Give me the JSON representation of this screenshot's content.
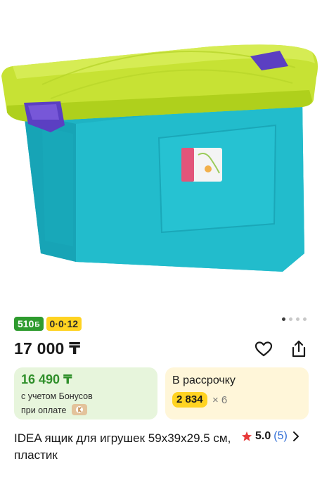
{
  "product": {
    "image_alt": "Пластиковый ящик с крышкой",
    "pager": {
      "count": 4,
      "active_index": 0
    },
    "badges": {
      "bonus": "510",
      "bonus_currency": "Б",
      "installment": "0·0·12"
    },
    "price": "17 000 ₸",
    "actions": {
      "favorite_icon": "heart-icon",
      "share_icon": "share-icon"
    },
    "bonus_card": {
      "price": "16 490 ₸",
      "line1": "с учетом Бонусов",
      "line2": "при оплате",
      "pay_icon": "kaspi-pay-icon"
    },
    "installment_card": {
      "title": "В рассрочку",
      "amount": "2 834",
      "months": "× 6"
    },
    "title": "IDEA ящик для игрушек 59x39x29.5 см, пластик",
    "rating": {
      "value": "5.0",
      "count": "(5)"
    }
  },
  "colors": {
    "box_body": "#21b8c8",
    "lid": "#c7e234",
    "clip": "#5b3fc2",
    "bonus_green": "#2e9b2e",
    "yellow": "#ffd321",
    "star": "#e83a3a",
    "link_blue": "#2f6dd6"
  }
}
